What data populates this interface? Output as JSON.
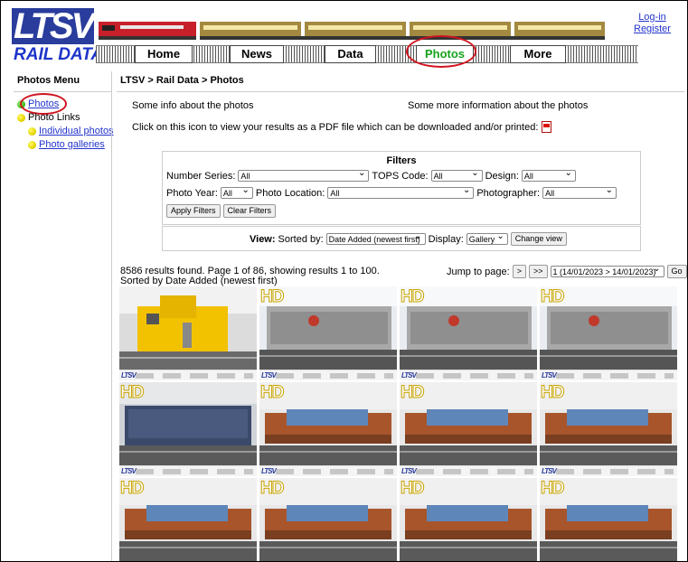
{
  "header": {
    "logo_top": "LTSV",
    "logo_bottom": "RAIL DATA",
    "nav": [
      "Home",
      "News",
      "Data",
      "Photos",
      "More"
    ],
    "login": "Log-in",
    "register": "Register"
  },
  "sidebar": {
    "title": "Photos Menu",
    "items": [
      "Photos",
      "Photo Links",
      "Individual photos",
      "Photo galleries"
    ]
  },
  "breadcrumb": "LTSV > Rail Data > Photos",
  "info": {
    "left": "Some info about the photos",
    "right": "Some more information about the photos",
    "pdf_text": "Click on this icon to view your results as a PDF file which can be downloaded and/or printed:"
  },
  "filters": {
    "title": "Filters",
    "number_series_label": "Number Series:",
    "number_series_value": "All",
    "tops_code_label": "TOPS Code:",
    "tops_code_value": "All",
    "design_label": "Design:",
    "design_value": "All",
    "photo_year_label": "Photo Year:",
    "photo_year_value": "All",
    "photo_location_label": "Photo Location:",
    "photo_location_value": "All",
    "photographer_label": "Photographer:",
    "photographer_value": "All",
    "apply": "Apply Filters",
    "clear": "Clear Filters"
  },
  "view": {
    "view_label": "View:",
    "sorted_label": "Sorted by:",
    "sorted_value": "Date Added (newest first)",
    "display_label": "Display:",
    "display_value": "Gallery",
    "change": "Change view"
  },
  "results": {
    "line1": "8586 results found. Page 1 of 86, showing results 1 to 100.",
    "line2": "Sorted by Date Added (newest first)",
    "jump_label": "Jump to page:",
    "next": ">",
    "last": ">>",
    "page_value": "1 (14/01/2023 > 14/01/2023)",
    "go": "Go"
  },
  "gallery": {
    "hd_label": "HD",
    "caption_logo": "LTSV",
    "photos": [
      {
        "kind": "yellow",
        "hd": false
      },
      {
        "kind": "grey",
        "hd": true
      },
      {
        "kind": "grey",
        "hd": true
      },
      {
        "kind": "grey",
        "hd": true
      },
      {
        "kind": "blue",
        "hd": true
      },
      {
        "kind": "rust",
        "hd": true
      },
      {
        "kind": "rust",
        "hd": true
      },
      {
        "kind": "rust",
        "hd": true
      },
      {
        "kind": "rust",
        "hd": true
      },
      {
        "kind": "rust",
        "hd": true
      },
      {
        "kind": "rust",
        "hd": true
      },
      {
        "kind": "rust",
        "hd": true
      }
    ]
  },
  "colors": {
    "link": "#2233cc",
    "highlight_circle": "#d0141f",
    "active_nav": "#17a31d",
    "logo_blue": "#2a3c9c"
  }
}
